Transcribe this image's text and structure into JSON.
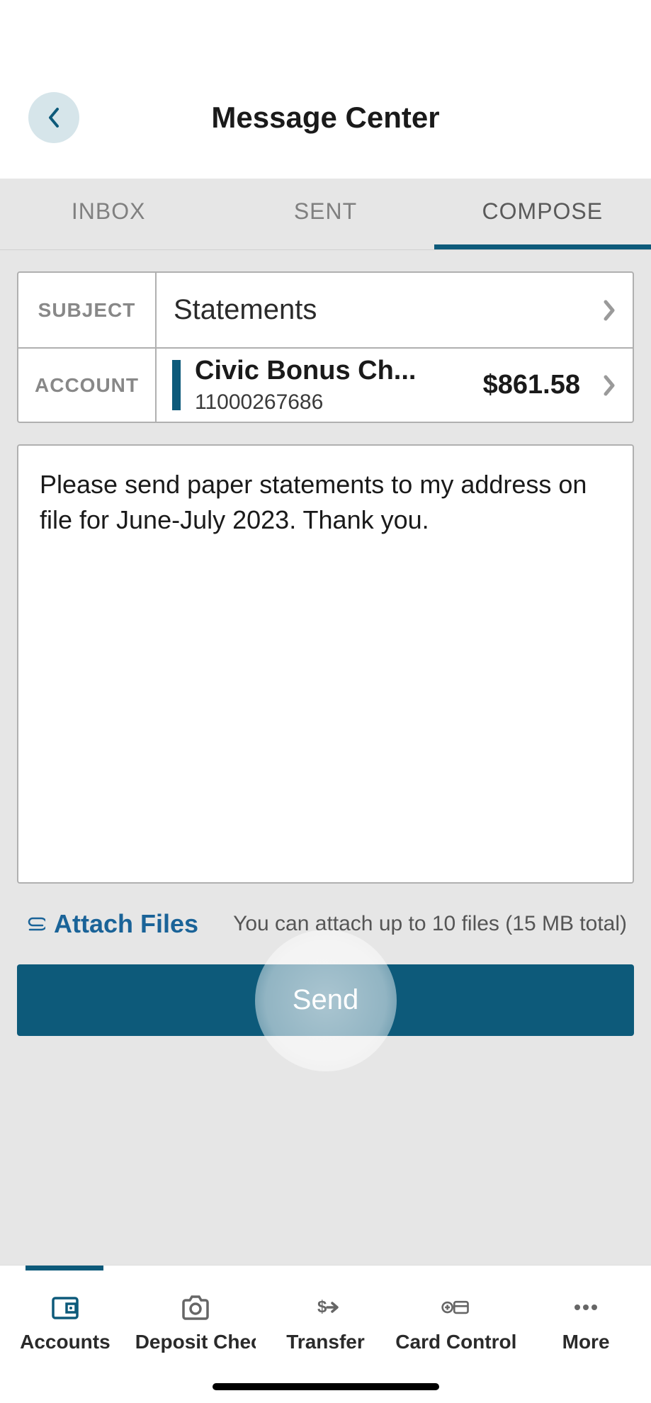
{
  "header": {
    "title": "Message Center"
  },
  "tabs": {
    "inbox": "INBOX",
    "sent": "SENT",
    "compose": "COMPOSE"
  },
  "form": {
    "subject_label": "SUBJECT",
    "subject_value": "Statements",
    "account_label": "ACCOUNT",
    "account_name": "Civic Bonus Ch...",
    "account_number": "11000267686",
    "account_balance": "$861.58",
    "message_body": "Please send paper statements to my address on file for June-July 2023. Thank you."
  },
  "attach": {
    "link_label": "Attach Files",
    "hint": "You can attach up to 10 files (15 MB total)"
  },
  "actions": {
    "send": "Send"
  },
  "nav": {
    "accounts": "Accounts",
    "deposit": "Deposit Chec",
    "transfer": "Transfer",
    "card": "Card Control",
    "more": "More"
  },
  "colors": {
    "primary": "#0d5a7a",
    "link": "#1a6398"
  }
}
